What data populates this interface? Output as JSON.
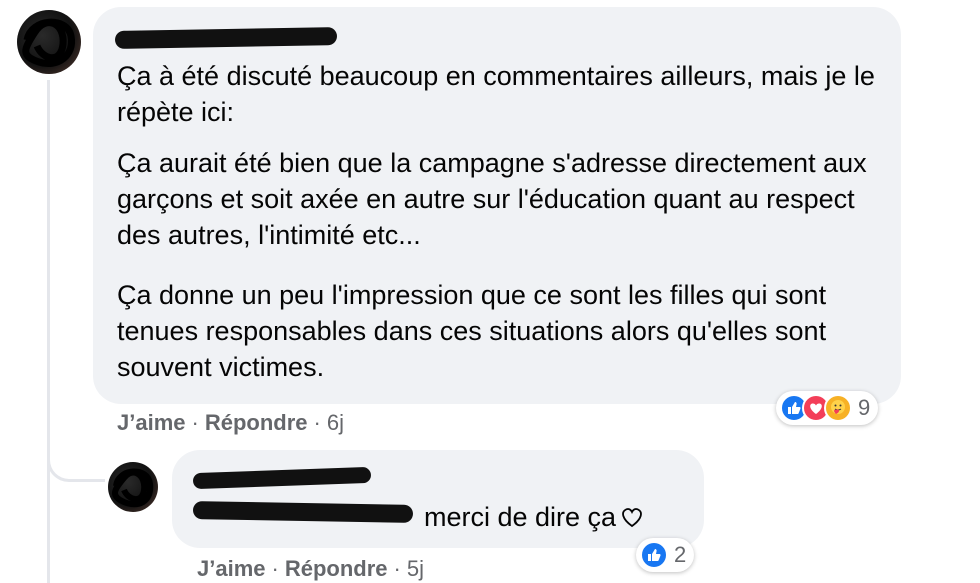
{
  "comment": {
    "paragraphs": [
      "Ça à été discuté beaucoup en commentaires ailleurs, mais je le répète ici:",
      "Ça aurait été bien que la campagne s'adresse directement aux garçons et soit axée en autre sur l'éducation quant au respect des autres, l'intimité etc...",
      "Ça donne un peu l'impression que ce sont les filles qui sont tenues responsables dans ces situations alors qu'elles sont souvent victimes."
    ],
    "actions": {
      "like": "J’aime",
      "reply": "Répondre",
      "separator": "·",
      "time": "6j"
    },
    "reactions": {
      "icons": [
        "like-icon",
        "love-icon",
        "care-icon"
      ],
      "count": "9"
    }
  },
  "reply": {
    "text": "merci de dire ça",
    "actions": {
      "like": "J’aime",
      "reply": "Répondre",
      "separator": "·",
      "time": "5j"
    },
    "reactions": {
      "icons": [
        "like-icon"
      ],
      "count": "2"
    }
  },
  "colors": {
    "bubble": "#f0f2f5",
    "meta_text": "#65676b",
    "like_blue": "#1877f2",
    "love_red": "#f33e58",
    "care_yellow": "#f7b125"
  }
}
